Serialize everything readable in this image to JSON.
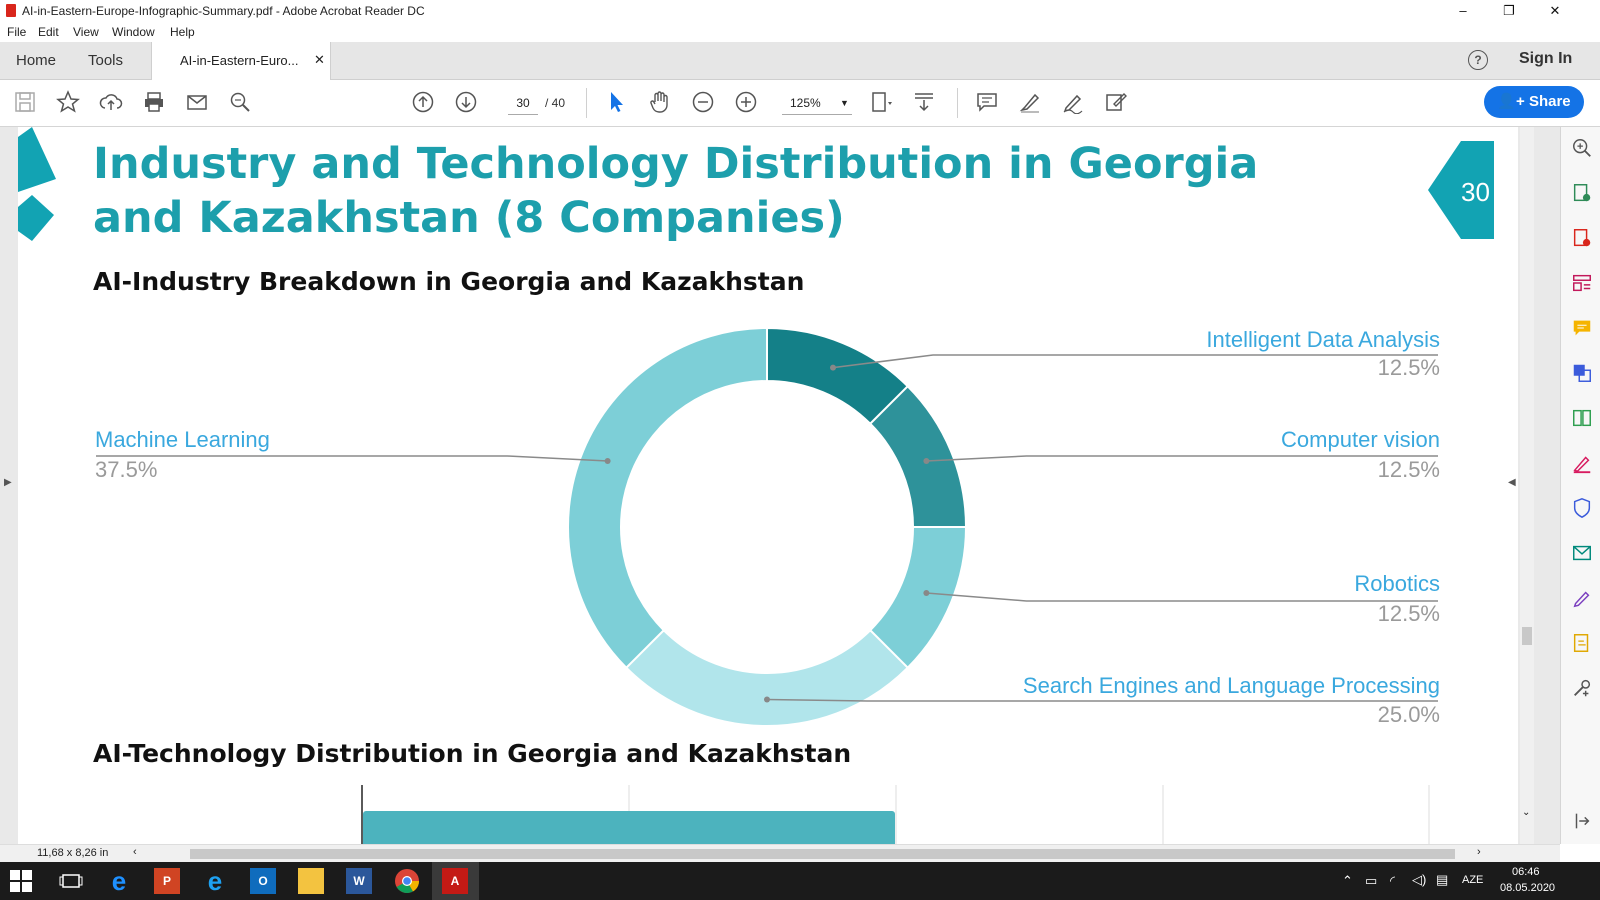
{
  "window": {
    "title": "AI-in-Eastern-Europe-Infographic-Summary.pdf - Adobe Acrobat Reader DC",
    "controls": [
      "–",
      "❐",
      "✕"
    ]
  },
  "menu": [
    "File",
    "Edit",
    "View",
    "Window",
    "Help"
  ],
  "tabs": {
    "home": "Home",
    "tools": "Tools",
    "document": "AI-in-Eastern-Euro...",
    "close": "✕"
  },
  "header": {
    "help": "?",
    "sign_in": "Sign In"
  },
  "toolbar": {
    "page_current": "30",
    "page_total": "/ 40",
    "zoom": "125%",
    "share": "Share"
  },
  "page": {
    "number": "30",
    "title": "Industry and Technology Distribution in Georgia and Kazakhstan (8 Companies)",
    "subtitle_industry": "AI-Industry Breakdown in Georgia and Kazakhstan",
    "subtitle_technology": "AI-Technology Distribution in Georgia and Kazakhstan"
  },
  "chart_data": [
    {
      "type": "pie",
      "title": "AI-Industry Breakdown in Georgia and Kazakhstan",
      "categories": [
        "Intelligent Data Analysis",
        "Computer vision",
        "Robotics",
        "Search Engines and Language Processing",
        "Machine Learning"
      ],
      "values": [
        12.5,
        12.5,
        12.5,
        25.0,
        37.5
      ],
      "labels": [
        "12.5%",
        "12.5%",
        "12.5%",
        "25.0%",
        "37.5%"
      ],
      "colors": [
        "#148088",
        "#2e929a",
        "#7dcfd7",
        "#b1e5eb",
        "#7dcfd7"
      ]
    },
    {
      "type": "bar",
      "title": "AI-Technology Distribution in Georgia and Kazakhstan"
    }
  ],
  "status": {
    "page_size": "11,68 x 8,26 in"
  },
  "taskbar": {
    "lang": "AZE",
    "time": "06:46",
    "date": "08.05.2020"
  },
  "colors": {
    "accent": "#1d9fac",
    "label_blue": "#3aa8de",
    "share_blue": "#1473e6"
  }
}
